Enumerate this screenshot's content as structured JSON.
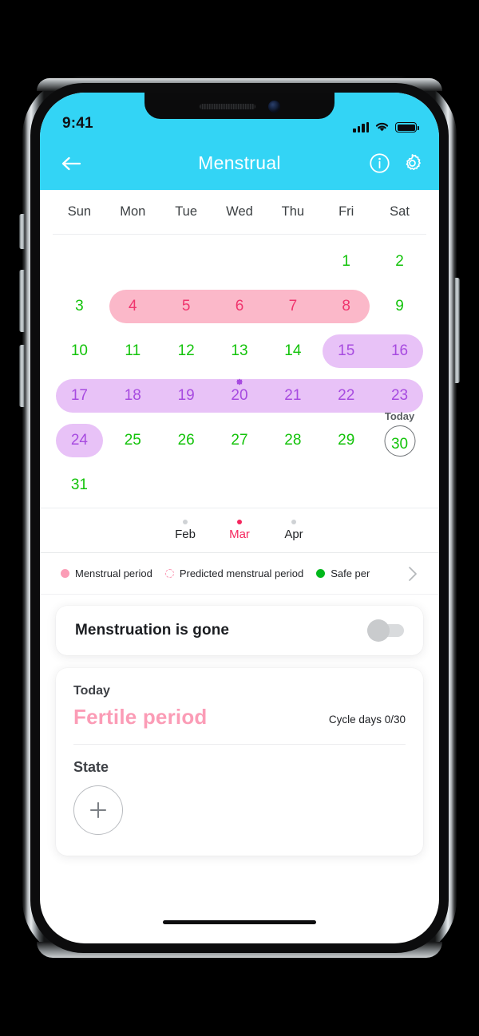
{
  "status_bar": {
    "time": "9:41",
    "signal_icon": "cellular-signal-icon",
    "wifi_icon": "wifi-icon",
    "battery_icon": "battery-icon"
  },
  "header": {
    "title": "Menstrual",
    "back_icon": "back-arrow-icon",
    "info_icon": "info-circle-icon",
    "settings_icon": "gear-icon",
    "background_color": "#33D4F5"
  },
  "calendar": {
    "weekdays": [
      "Sun",
      "Mon",
      "Tue",
      "Wed",
      "Thu",
      "Fri",
      "Sat"
    ],
    "weeks": [
      [
        null,
        null,
        null,
        null,
        null,
        "1",
        "2"
      ],
      [
        "3",
        "4",
        "5",
        "6",
        "7",
        "8",
        "9"
      ],
      [
        "10",
        "11",
        "12",
        "13",
        "14",
        "15",
        "16"
      ],
      [
        "17",
        "18",
        "19",
        "20",
        "21",
        "22",
        "23"
      ],
      [
        "24",
        "25",
        "26",
        "27",
        "28",
        "29",
        "30"
      ],
      [
        "31",
        null,
        null,
        null,
        null,
        null,
        null
      ]
    ],
    "menstrual_days": [
      "4",
      "5",
      "6",
      "7",
      "8"
    ],
    "fertile_days": [
      "15",
      "16",
      "17",
      "18",
      "19",
      "20",
      "21",
      "22",
      "23",
      "24"
    ],
    "ovulation_day": "20",
    "today_day": "30",
    "today_label": "Today",
    "colors": {
      "safe_day": "#13c30a",
      "menstrual_day": "#F0356E",
      "menstrual_pill": "#FBB8C9",
      "fertile_day": "#A74BE0",
      "fertile_pill": "#E8C2F7"
    }
  },
  "month_switcher": {
    "months": [
      {
        "name": "Feb",
        "active": false
      },
      {
        "name": "Mar",
        "active": true
      },
      {
        "name": "Apr",
        "active": false
      }
    ],
    "active_color": "#F5265E"
  },
  "legend": {
    "items": [
      {
        "label": "Menstrual period",
        "marker": "solid-pink-dot"
      },
      {
        "label": "Predicted menstrual period",
        "marker": "dashed-pink-circle"
      },
      {
        "label": "Safe per",
        "marker": "solid-green-dot"
      }
    ],
    "chevron_icon": "chevron-right-icon"
  },
  "menstruation_gone_card": {
    "title": "Menstruation is gone",
    "toggle_state": "off",
    "toggle_icon": "toggle-switch"
  },
  "today_card": {
    "today_label": "Today",
    "phase": "Fertile period",
    "phase_color": "#FB9CB6",
    "cycle_days_label": "Cycle days",
    "cycle_days_value": "0/30",
    "state_label": "State",
    "add_icon": "plus-icon"
  },
  "home_indicator": "home-indicator-bar"
}
